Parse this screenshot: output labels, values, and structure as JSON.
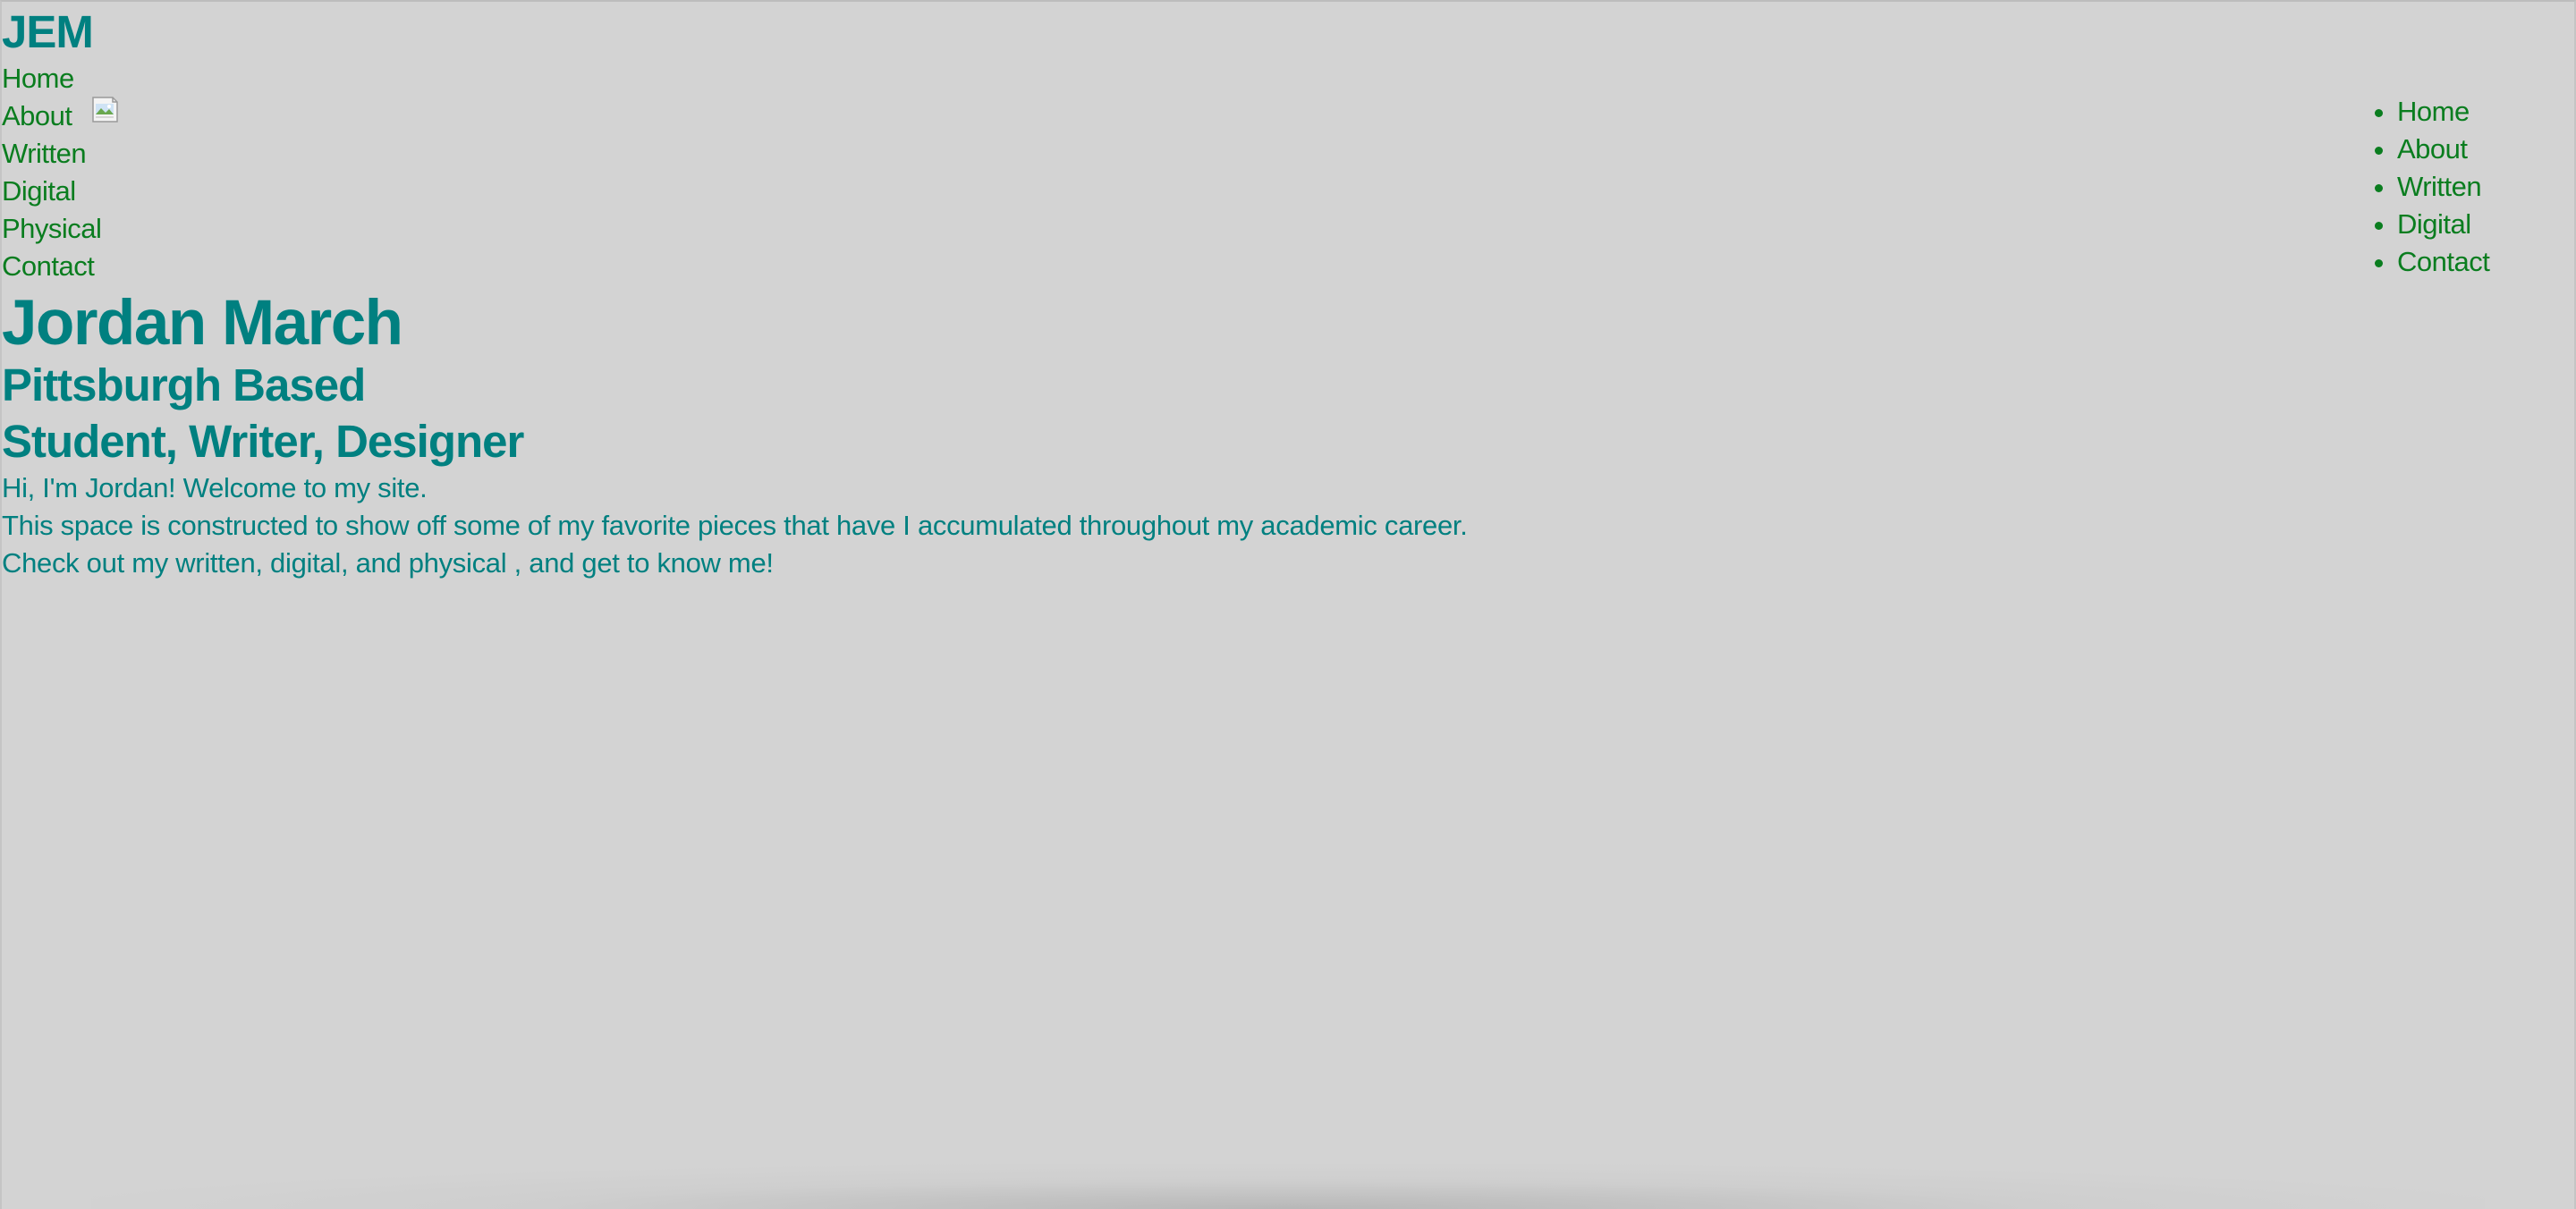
{
  "site": {
    "logo_text": "JEM"
  },
  "left_nav": {
    "items": [
      {
        "label": "Home"
      },
      {
        "label": "About"
      },
      {
        "label": "Written"
      },
      {
        "label": "Digital"
      },
      {
        "label": "Physical"
      },
      {
        "label": "Contact"
      }
    ]
  },
  "right_nav": {
    "items": [
      {
        "label": "Home"
      },
      {
        "label": "About"
      },
      {
        "label": "Written"
      },
      {
        "label": "Digital"
      },
      {
        "label": "Contact"
      }
    ]
  },
  "hero": {
    "title": "Jordan March",
    "subtitle_1": "Pittsburgh Based",
    "subtitle_2": "Student, Writer, Designer",
    "paragraphs": [
      "Hi, I'm Jordan! Welcome to my site.",
      "This space is constructed to show off some of my favorite pieces that have I accumulated throughout my academic career.",
      "Check out my written, digital, and physical , and get to know me!"
    ]
  },
  "icons": {
    "broken_image": "broken-image-icon"
  },
  "colors": {
    "background": "#d3d3d3",
    "heading": "#008080",
    "link": "#0a7d1f"
  }
}
